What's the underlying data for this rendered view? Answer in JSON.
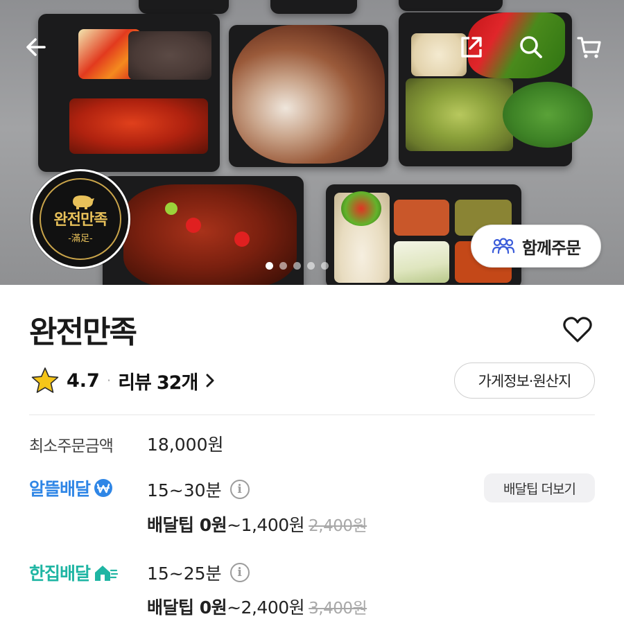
{
  "store": {
    "name": "완전만족",
    "logo_text": "완전만족",
    "logo_subtext": "-滿足-",
    "rating": "4.7",
    "rating_separator": "·",
    "review_label": "리뷰",
    "review_count": "32개",
    "info_button": "가게정보·원산지",
    "together_order_button": "함께주문"
  },
  "carousel": {
    "total": 5,
    "active_index": 0
  },
  "order": {
    "min_order_label": "최소주문금액",
    "min_order_value": "18,000원"
  },
  "delivery": [
    {
      "brand": "알뜰배달",
      "time": "15~30분",
      "tip_prefix": "배달팁 0원",
      "tip_range": "~1,400원",
      "original_tip": "2,400원",
      "color": "#2f86e6"
    },
    {
      "brand": "한집배달",
      "time": "15~25분",
      "tip_prefix": "배달팁 0원",
      "tip_range": "~2,400원",
      "original_tip": "3,400원",
      "color": "#1fb5a3"
    }
  ],
  "more_tip_button": "배달팁 더보기",
  "icons": {
    "back": "back-arrow-icon",
    "share": "share-icon",
    "search": "search-icon",
    "cart": "cart-icon",
    "heart": "heart-icon",
    "star": "star-icon",
    "people": "people-icon",
    "info": "info-icon"
  },
  "colors": {
    "star": "#f5c518",
    "blue_brand": "#2f86e6",
    "teal_brand": "#1fb5a3"
  }
}
